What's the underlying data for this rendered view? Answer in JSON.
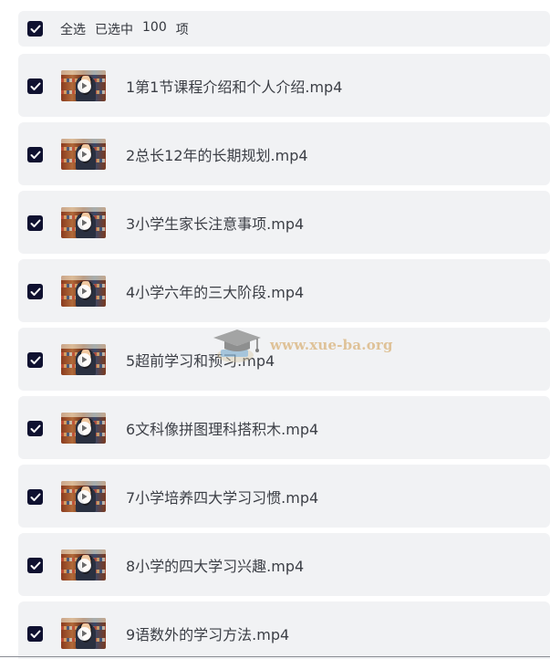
{
  "header": {
    "select_all_label": "全选",
    "selected_prefix": "已选中",
    "selected_count": "100",
    "selected_suffix": "项",
    "checked": true
  },
  "files": [
    {
      "name": "1第1节课程介绍和个人介绍.mp4",
      "checked": true
    },
    {
      "name": "2总长12年的长期规划.mp4",
      "checked": true
    },
    {
      "name": "3小学生家长注意事项.mp4",
      "checked": true
    },
    {
      "name": "4小学六年的三大阶段.mp4",
      "checked": true
    },
    {
      "name": "5超前学习和预习.mp4",
      "checked": true
    },
    {
      "name": "6文科像拼图理科搭积木.mp4",
      "checked": true
    },
    {
      "name": "7小学培养四大学习习惯.mp4",
      "checked": true
    },
    {
      "name": "8小学的四大学习兴趣.mp4",
      "checked": true
    },
    {
      "name": "9语数外的学习方法.mp4",
      "checked": true
    }
  ],
  "watermark": {
    "text": "www.xue-ba.org",
    "icon": "graduation-cap-icon"
  },
  "colors": {
    "checkbox": "#0f1130",
    "row_bg": "#f1f2f4",
    "watermark": "#d9b27a"
  }
}
